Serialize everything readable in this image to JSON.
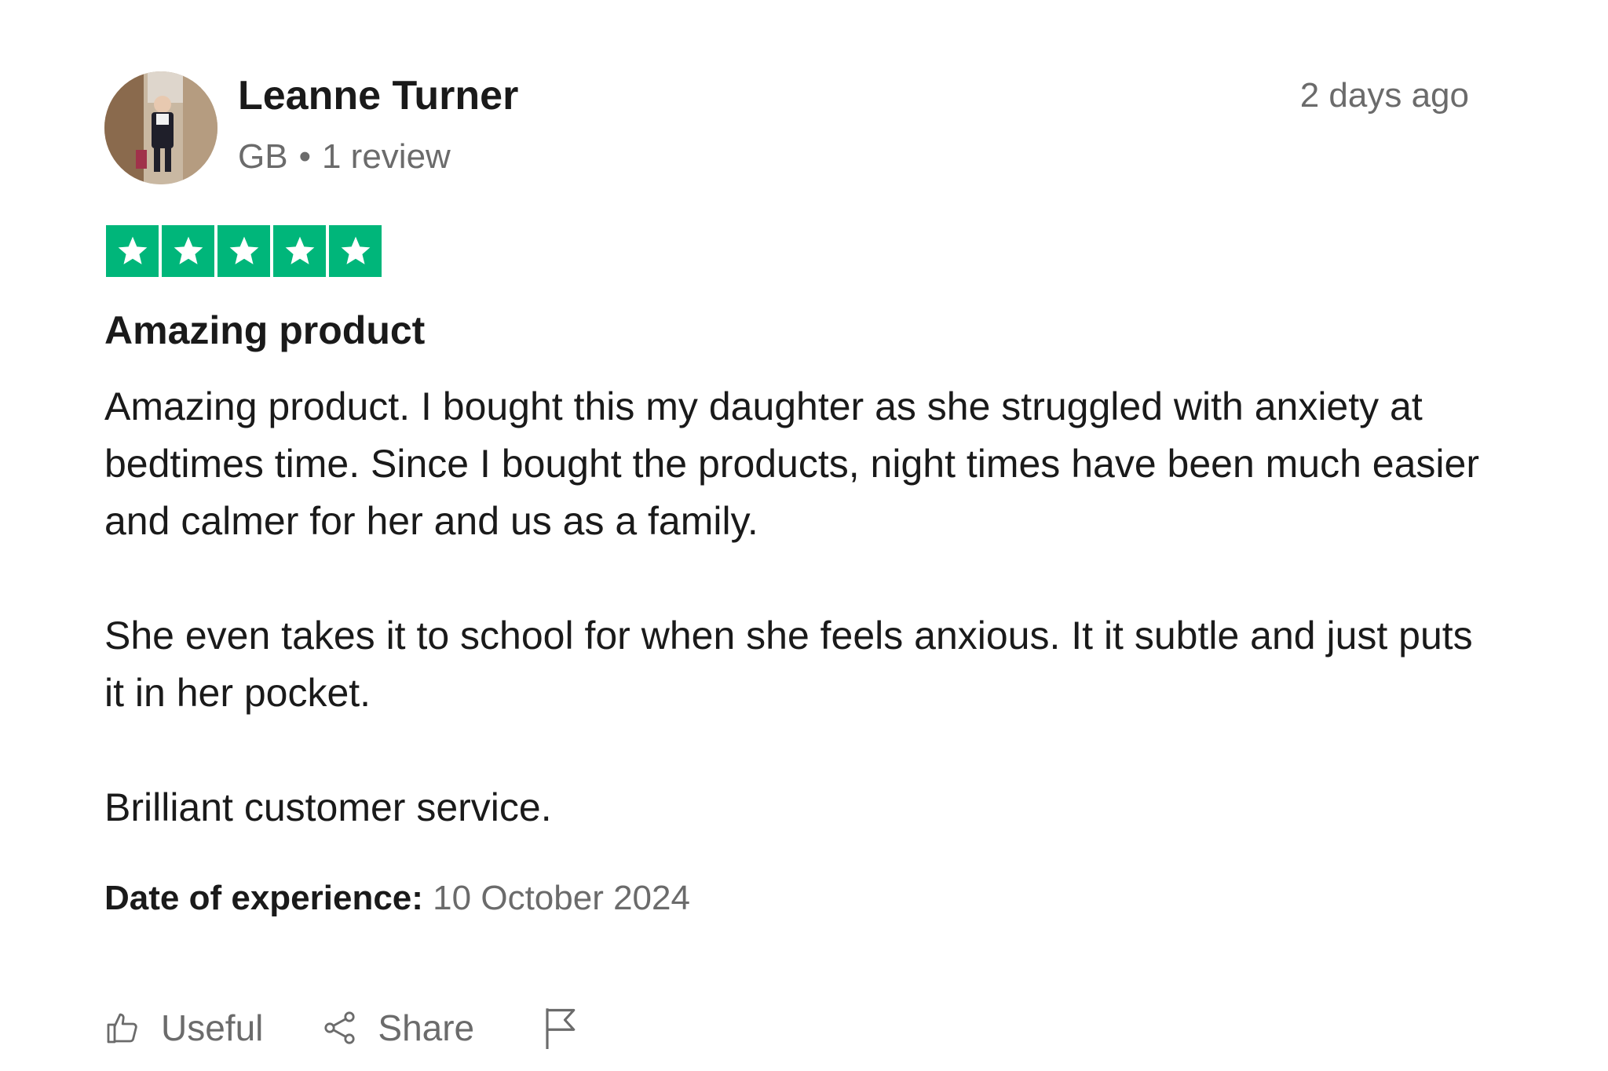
{
  "reviewer": {
    "name": "Leanne Turner",
    "country": "GB",
    "separator": "•",
    "review_count": "1 review",
    "avatar_icon": "user-photo-avatar"
  },
  "posted": "2 days ago",
  "rating": {
    "stars": 5,
    "max": 5,
    "color": "#00b67a"
  },
  "review": {
    "title": "Amazing product",
    "paragraphs": [
      "Amazing product. I bought this my daughter as she struggled with anxiety at bedtimes time. Since I bought the products, night times have been much easier and calmer for her and us as a family.",
      "She even takes it to school for when she feels anxious. It it subtle and just puts it in her pocket.",
      "Brilliant customer service."
    ]
  },
  "experience": {
    "label": "Date of experience:",
    "date": "10 October 2024"
  },
  "actions": {
    "useful_label": "Useful",
    "share_label": "Share",
    "useful_icon": "thumbs-up-icon",
    "share_icon": "share-icon",
    "report_icon": "flag-icon"
  }
}
